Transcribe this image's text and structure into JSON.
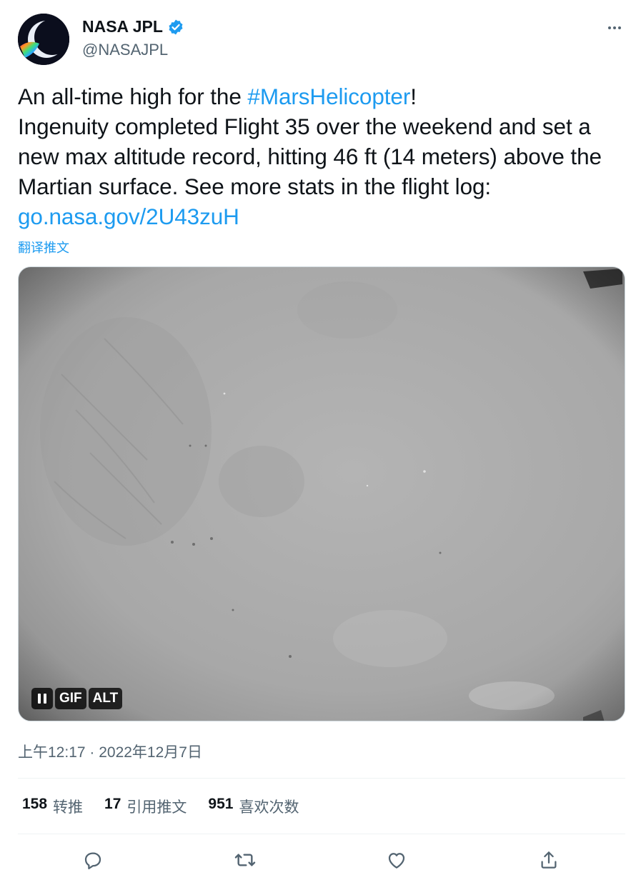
{
  "author": {
    "display_name": "NASA JPL",
    "handle": "@NASAJPL",
    "verified": true,
    "avatar_icon": "nasa-jpl-logo-icon"
  },
  "tweet": {
    "line1_prefix": "An all-time high for the ",
    "hashtag": "#MarsHelicopter",
    "line1_suffix": "!",
    "body": "Ingenuity completed Flight 35 over the weekend and set a new max altitude record, hitting 46 ft (14 meters) above the Martian surface. See more stats in the flight log: ",
    "link_text": "go.nasa.gov/2U43zuH",
    "translate_label": "翻译推文"
  },
  "media": {
    "type": "gif",
    "pause_icon": "pause-icon",
    "gif_badge": "GIF",
    "alt_badge": "ALT"
  },
  "timestamp": "上午12:17 · 2022年12月7日",
  "stats": {
    "retweets": {
      "count": "158",
      "label": "转推"
    },
    "quotes": {
      "count": "17",
      "label": "引用推文"
    },
    "likes": {
      "count": "951",
      "label": "喜欢次数"
    }
  },
  "actions": [
    "reply-icon",
    "retweet-icon",
    "like-icon",
    "share-icon"
  ],
  "colors": {
    "link": "#1d9bf0",
    "secondary_text": "#536471",
    "primary_text": "#0f1419",
    "divider": "#eff3f4"
  }
}
